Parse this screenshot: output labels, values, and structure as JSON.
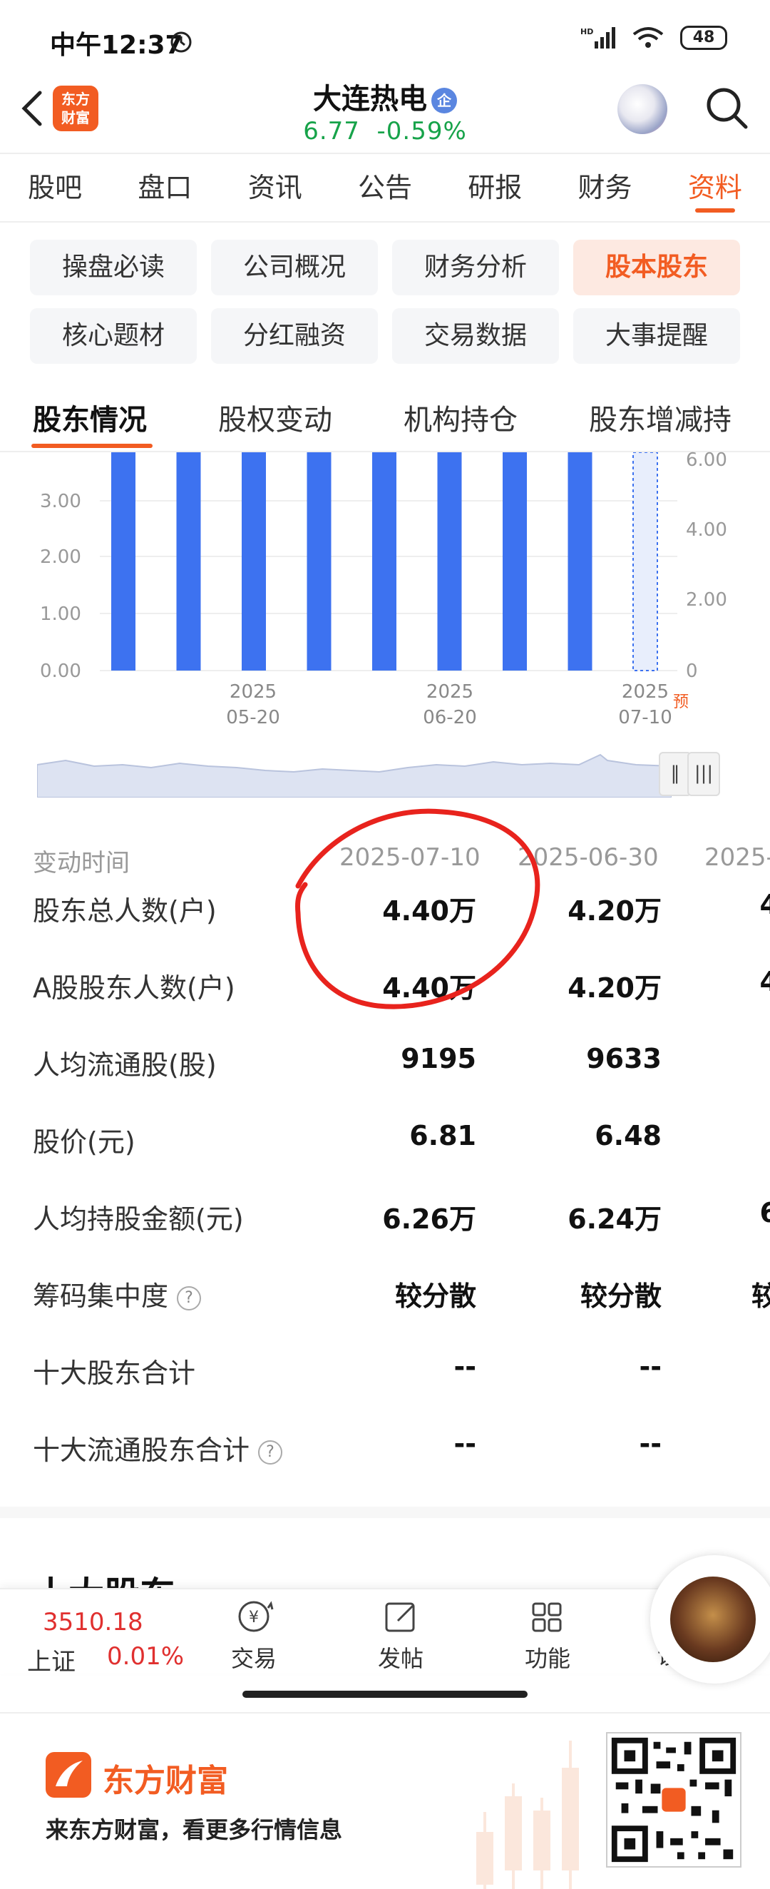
{
  "status_bar": {
    "time": "中午12:37",
    "battery": "48"
  },
  "header": {
    "logo_line1": "东方",
    "logo_line2": "财富",
    "stock_name": "大连热电",
    "badge": "企",
    "price": "6.77",
    "change": "-0.59%",
    "price_color": "#17a34a"
  },
  "tabs": [
    "股吧",
    "盘口",
    "资讯",
    "公告",
    "研报",
    "财务",
    "资料"
  ],
  "active_tab": "资料",
  "grid_buttons": [
    [
      "操盘必读",
      "公司概况",
      "财务分析",
      "股本股东"
    ],
    [
      "核心题材",
      "分红融资",
      "交易数据",
      "大事提醒"
    ]
  ],
  "sub_tabs": [
    "股东情况",
    "股权变动",
    "机构持仓",
    "股东增减持"
  ],
  "chart_data": {
    "type": "bar",
    "left_axis_ticks": [
      "3.00",
      "2.00",
      "1.00",
      "0.00"
    ],
    "right_axis_ticks": [
      "6.00",
      "4.00",
      "2.00",
      "0"
    ],
    "x_ticks": [
      {
        "year": "2025",
        "date": "05-20"
      },
      {
        "year": "2025",
        "date": "06-20"
      },
      {
        "year": "2025",
        "date": "07-10"
      }
    ],
    "forecast_label": "预",
    "bar_color": "#3d72f0",
    "bars_shown": 9,
    "last_bar_dashed": true
  },
  "table": {
    "header_label": "变动时间",
    "dates": [
      "2025-07-10",
      "2025-06-30",
      "2025-"
    ],
    "rows": [
      {
        "label": "股东总人数(户)",
        "values": [
          "4.40万",
          "4.20万",
          "4"
        ]
      },
      {
        "label": "A股股东人数(户)",
        "values": [
          "4.40万",
          "4.20万",
          "4"
        ]
      },
      {
        "label": "人均流通股(股)",
        "values": [
          "9195",
          "9633",
          ""
        ]
      },
      {
        "label": "股价(元)",
        "values": [
          "6.81",
          "6.48",
          ""
        ]
      },
      {
        "label": "人均持股金额(元)",
        "values": [
          "6.26万",
          "6.24万",
          "6"
        ]
      },
      {
        "label": "筹码集中度",
        "help": true,
        "values": [
          "较分散",
          "较分散",
          "较"
        ]
      },
      {
        "label": "十大股东合计",
        "values": [
          "--",
          "--",
          ""
        ]
      },
      {
        "label": "十大流通股东合计",
        "help": true,
        "values": [
          "--",
          "--",
          ""
        ]
      }
    ]
  },
  "section_title": "十大股东",
  "bottom_bar": {
    "index_value": "3510.18",
    "index_name": "上证",
    "index_change": "0.01%",
    "items": [
      "交易",
      "发帖",
      "功能",
      "设自选"
    ]
  },
  "footer": {
    "brand": "东方财富",
    "tagline": "来东方财富，看更多行情信息"
  }
}
